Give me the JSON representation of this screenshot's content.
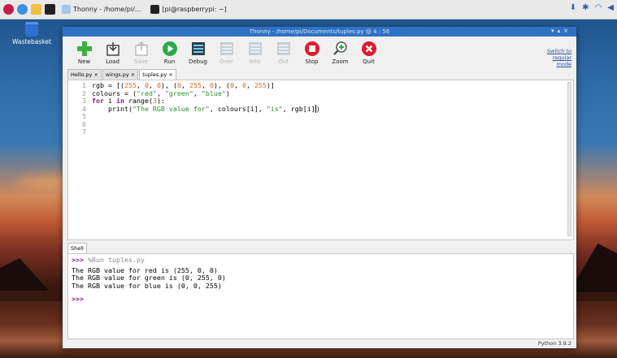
{
  "taskbar": {
    "tasks": [
      {
        "label": "Thonny - /home/pi/..."
      },
      {
        "label": "[pi@raspberrypi: ~]"
      }
    ]
  },
  "desktop": {
    "wastebasket_label": "Wastebasket"
  },
  "window": {
    "title": "Thonny - /home/pi/Documents/tuples.py @ 4 : 56",
    "switch_mode": [
      "Switch to",
      "regular",
      "mode"
    ],
    "toolbar": [
      {
        "label": "New",
        "icon": "new-file-icon",
        "enabled": true
      },
      {
        "label": "Load",
        "icon": "load-icon",
        "enabled": true
      },
      {
        "label": "Save",
        "icon": "save-icon",
        "enabled": false
      },
      {
        "label": "Run",
        "icon": "run-icon",
        "enabled": true
      },
      {
        "label": "Debug",
        "icon": "debug-icon",
        "enabled": true
      },
      {
        "label": "Over",
        "icon": "step-over-icon",
        "enabled": false
      },
      {
        "label": "Into",
        "icon": "step-into-icon",
        "enabled": false
      },
      {
        "label": "Out",
        "icon": "step-out-icon",
        "enabled": false
      },
      {
        "label": "Stop",
        "icon": "stop-icon",
        "enabled": true
      },
      {
        "label": "Zoom",
        "icon": "zoom-icon",
        "enabled": true
      },
      {
        "label": "Quit",
        "icon": "quit-icon",
        "enabled": true
      }
    ],
    "tabs": [
      "Hello.py ×",
      "wings.py ×",
      "tuples.py ×"
    ],
    "active_tab": 2,
    "code_line_numbers": [
      "1",
      "2",
      "3",
      "4",
      "5",
      "6",
      "7"
    ],
    "shell_tab": "Shell",
    "shell": {
      "prompt": ">>>",
      "run_command": "%Run tuples.py",
      "output": [
        "The RGB value for red is (255, 0, 0)",
        "The RGB value for green is (0, 255, 0)",
        "The RGB value for blue is (0, 0, 255)"
      ]
    },
    "status": "Python 3.9.2"
  },
  "colors": {
    "titlebar": "#2f72c4",
    "keyword": "#7a1f8a",
    "number": "#d2691e",
    "string": "#2e8b2e"
  }
}
